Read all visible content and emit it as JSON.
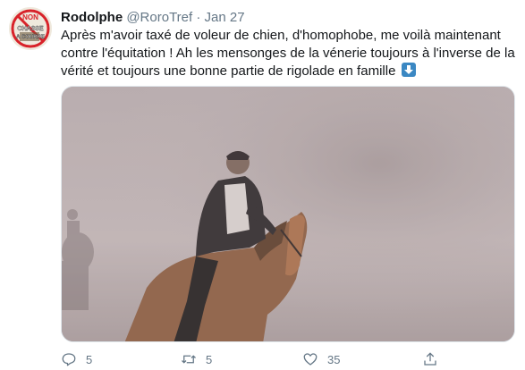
{
  "tweet": {
    "author": {
      "name": "Rodolphe",
      "handle": "@RoroTref",
      "avatar_text": [
        "NON",
        "CHASSE",
        "A COURRE"
      ]
    },
    "separator": "·",
    "date": "Jan 27",
    "text": "Après m'avoir taxé de voleur de chien, d'homophobe, me voilà maintenant contre l'équitation ! Ah les mensonges de la vénerie toujours à l'inverse de la vérité et toujours une bonne partie de rigolade en famille",
    "emoji": "down-arrow-emoji",
    "media": {
      "description_icon": "photo"
    },
    "actions": {
      "reply_count": "5",
      "retweet_count": "5",
      "like_count": "35"
    }
  },
  "colors": {
    "text": "#14171a",
    "secondary": "#657786",
    "emoji_blue": "#3b88c3",
    "avatar_red": "#d8232a"
  }
}
